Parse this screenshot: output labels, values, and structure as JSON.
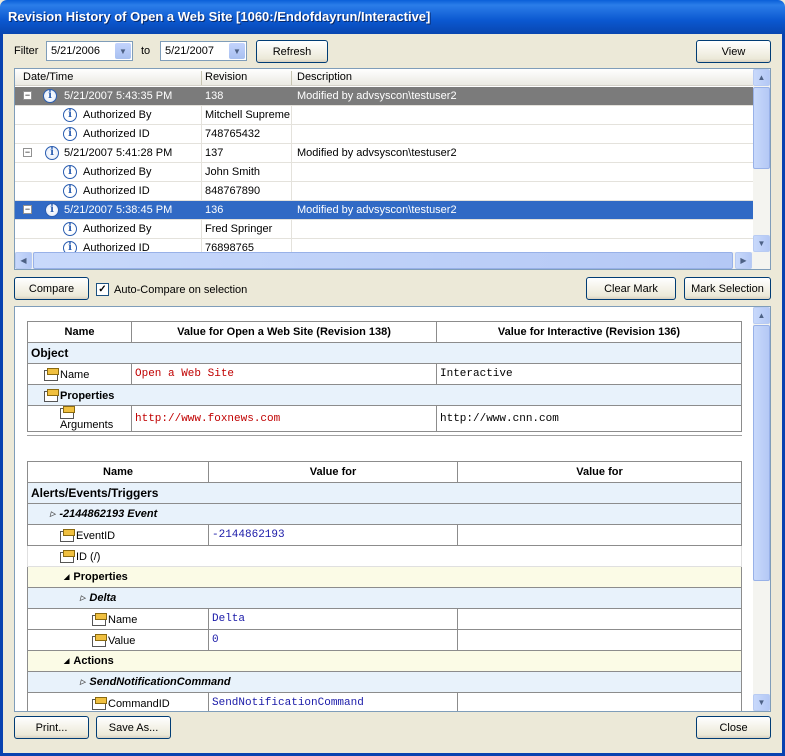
{
  "window": {
    "title": "Revision History of Open a Web Site [1060:/Endofdayrun/Interactive]"
  },
  "filter": {
    "label": "Filter",
    "from": "5/21/2006",
    "to_label": "to",
    "to": "5/21/2007",
    "refresh": "Refresh",
    "view": "View"
  },
  "grid": {
    "headers": [
      "Date/Time",
      "Revision",
      "Description"
    ],
    "rows": [
      {
        "date": "5/21/2007 5:43:35 PM",
        "rev": "138",
        "desc": "Modified by advsyscon\\testuser2"
      },
      {
        "label": "Authorized By",
        "value": "Mitchell Supreme"
      },
      {
        "label": "Authorized ID",
        "value": "748765432"
      },
      {
        "date": "5/21/2007 5:41:28 PM",
        "rev": "137",
        "desc": "Modified by advsyscon\\testuser2"
      },
      {
        "label": "Authorized By",
        "value": "John Smith"
      },
      {
        "label": "Authorized ID",
        "value": "848767890"
      },
      {
        "date": "5/21/2007 5:38:45 PM",
        "rev": "136",
        "desc": "Modified by advsyscon\\testuser2"
      },
      {
        "label": "Authorized By",
        "value": "Fred Springer"
      },
      {
        "label": "Authorized ID",
        "value": "76898765"
      }
    ]
  },
  "toolbar": {
    "compare": "Compare",
    "auto_compare": "Auto-Compare on selection",
    "clear_mark": "Clear Mark",
    "mark_selection": "Mark Selection"
  },
  "cmp1": {
    "headers": [
      "Name",
      "Value for Open a Web Site (Revision 138)",
      "Value for Interactive (Revision 136)"
    ],
    "object": "Object",
    "name_label": "Name",
    "name_left": "Open a Web Site",
    "name_right": "Interactive",
    "properties": "Properties",
    "args_label": "Arguments",
    "args_left": "http://www.foxnews.com",
    "args_right": "http://www.cnn.com"
  },
  "cmp2": {
    "headers": [
      "Name",
      "Value for",
      "Value for"
    ],
    "section": "Alerts/Events/Triggers",
    "event": "-2144862193 Event",
    "eventid_label": "EventID",
    "eventid_val": "-2144862193",
    "id_label": "ID (/)",
    "properties": "Properties",
    "delta": "Delta",
    "delta_name_label": "Name",
    "delta_name_val": "Delta",
    "value_label": "Value",
    "value_val": "0",
    "actions": "Actions",
    "cmd": "SendNotificationCommand",
    "cmdid_label": "CommandID",
    "cmdid_val": "SendNotificationCommand"
  },
  "footer": {
    "print": "Print...",
    "save_as": "Save As...",
    "close": "Close"
  }
}
